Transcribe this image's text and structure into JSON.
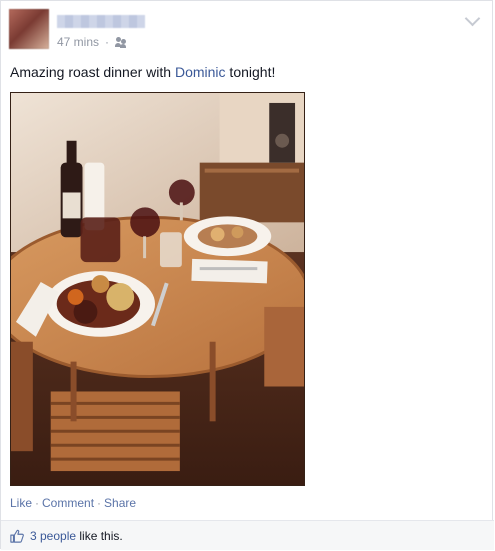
{
  "post": {
    "time": "47 mins",
    "separator": "·",
    "text_before": "Amazing roast dinner with ",
    "tagged_person": "Dominic",
    "text_after": " tonight!"
  },
  "actions": {
    "like": "Like",
    "comment": "Comment",
    "share": "Share",
    "sep": "·"
  },
  "likes": {
    "count_text": "3 people",
    "suffix": " like this."
  },
  "icons": {
    "audience": "friends-icon",
    "menu": "chevron-down-icon",
    "like": "thumbs-up-icon"
  },
  "colors": {
    "link": "#3b5998",
    "meta": "#9197a3"
  }
}
